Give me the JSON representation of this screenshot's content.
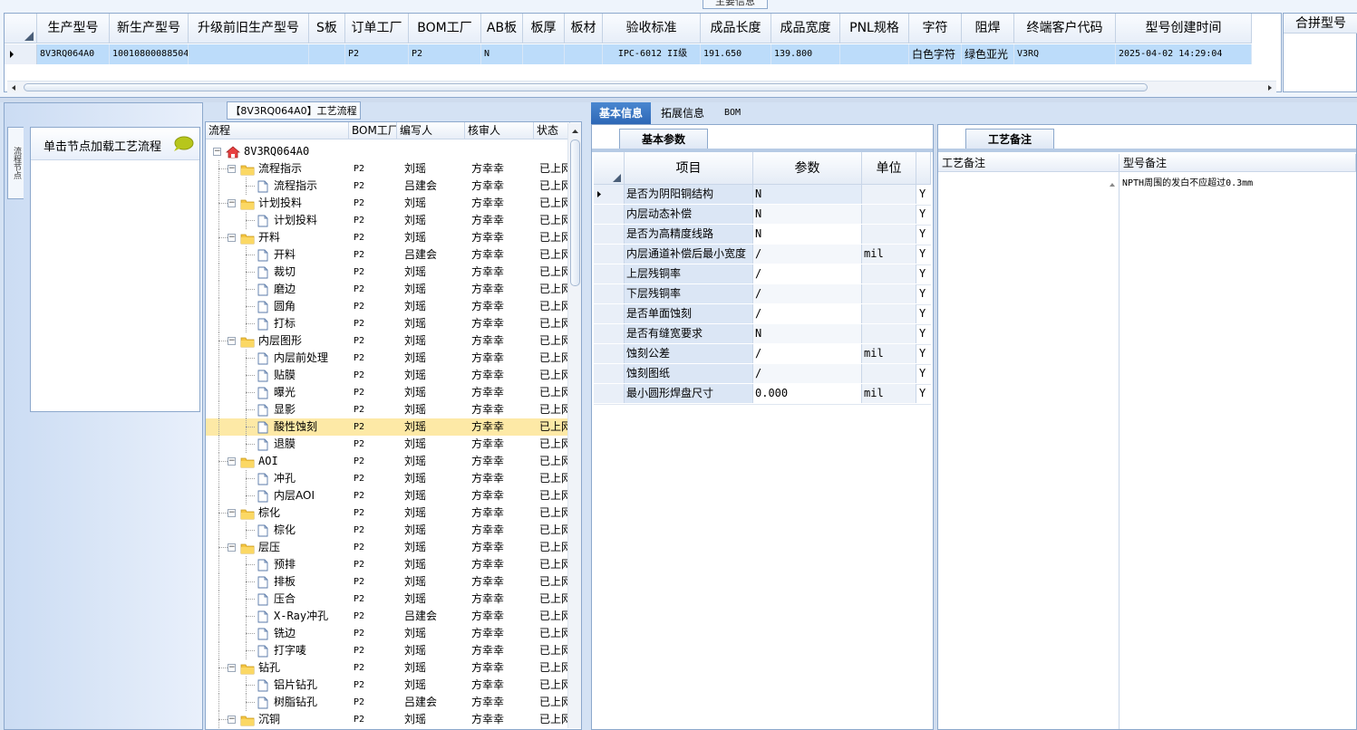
{
  "top": {
    "section_title": "主要信息",
    "columns": [
      "生产型号",
      "新生产型号",
      "升级前旧生产型号",
      "S板",
      "订单工厂",
      "BOM工厂",
      "AB板",
      "板厚",
      "板材",
      "验收标准",
      "成品长度",
      "成品宽度",
      "PNL规格",
      "字符",
      "阻焊",
      "终端客户代码",
      "型号创建时间"
    ],
    "row": [
      "8V3RQ064A0",
      "10010800088504",
      "",
      "",
      "P2",
      "P2",
      "N",
      "",
      "",
      "IPC-6012 II级",
      "191.650",
      "139.800",
      "",
      "白色字符",
      "绿色亚光",
      "V3RQ",
      "2025-04-02 14:29:04"
    ],
    "right_column": "合拼型号"
  },
  "left": {
    "vertical_tab": "流程节点",
    "node_hint": "单击节点加载工艺流程",
    "icons": {
      "chat": "speech-bubble-icon"
    }
  },
  "tree": {
    "title": "【8V3RQ064A0】工艺流程",
    "columns": [
      "流程",
      "BOM工厂",
      "编写人",
      "核审人",
      "状态"
    ],
    "root": "8V3RQ064A0",
    "rows": [
      {
        "name": "流程指示",
        "level": 1,
        "type": "folder",
        "factory": "P2",
        "writer": "刘瑶",
        "reviewer": "方幸幸",
        "status": "已上网"
      },
      {
        "name": "流程指示",
        "level": 2,
        "type": "file",
        "factory": "P2",
        "writer": "吕建会",
        "reviewer": "方幸幸",
        "status": "已上网"
      },
      {
        "name": "计划投料",
        "level": 1,
        "type": "folder",
        "factory": "P2",
        "writer": "刘瑶",
        "reviewer": "方幸幸",
        "status": "已上网"
      },
      {
        "name": "计划投料",
        "level": 2,
        "type": "file",
        "factory": "P2",
        "writer": "刘瑶",
        "reviewer": "方幸幸",
        "status": "已上网"
      },
      {
        "name": "开料",
        "level": 1,
        "type": "folder",
        "factory": "P2",
        "writer": "刘瑶",
        "reviewer": "方幸幸",
        "status": "已上网"
      },
      {
        "name": "开料",
        "level": 2,
        "type": "file",
        "factory": "P2",
        "writer": "吕建会",
        "reviewer": "方幸幸",
        "status": "已上网"
      },
      {
        "name": "裁切",
        "level": 2,
        "type": "file",
        "factory": "P2",
        "writer": "刘瑶",
        "reviewer": "方幸幸",
        "status": "已上网"
      },
      {
        "name": "磨边",
        "level": 2,
        "type": "file",
        "factory": "P2",
        "writer": "刘瑶",
        "reviewer": "方幸幸",
        "status": "已上网"
      },
      {
        "name": "圆角",
        "level": 2,
        "type": "file",
        "factory": "P2",
        "writer": "刘瑶",
        "reviewer": "方幸幸",
        "status": "已上网"
      },
      {
        "name": "打标",
        "level": 2,
        "type": "file",
        "factory": "P2",
        "writer": "刘瑶",
        "reviewer": "方幸幸",
        "status": "已上网"
      },
      {
        "name": "内层图形",
        "level": 1,
        "type": "folder",
        "factory": "P2",
        "writer": "刘瑶",
        "reviewer": "方幸幸",
        "status": "已上网"
      },
      {
        "name": "内层前处理",
        "level": 2,
        "type": "file",
        "factory": "P2",
        "writer": "刘瑶",
        "reviewer": "方幸幸",
        "status": "已上网"
      },
      {
        "name": "贴膜",
        "level": 2,
        "type": "file",
        "factory": "P2",
        "writer": "刘瑶",
        "reviewer": "方幸幸",
        "status": "已上网"
      },
      {
        "name": "曝光",
        "level": 2,
        "type": "file",
        "factory": "P2",
        "writer": "刘瑶",
        "reviewer": "方幸幸",
        "status": "已上网"
      },
      {
        "name": "显影",
        "level": 2,
        "type": "file",
        "factory": "P2",
        "writer": "刘瑶",
        "reviewer": "方幸幸",
        "status": "已上网"
      },
      {
        "name": "酸性蚀刻",
        "level": 2,
        "type": "file",
        "factory": "P2",
        "writer": "刘瑶",
        "reviewer": "方幸幸",
        "status": "已上网",
        "selected": true
      },
      {
        "name": "退膜",
        "level": 2,
        "type": "file",
        "factory": "P2",
        "writer": "刘瑶",
        "reviewer": "方幸幸",
        "status": "已上网"
      },
      {
        "name": "AOI",
        "level": 1,
        "type": "folder",
        "factory": "P2",
        "writer": "刘瑶",
        "reviewer": "方幸幸",
        "status": "已上网"
      },
      {
        "name": "冲孔",
        "level": 2,
        "type": "file",
        "factory": "P2",
        "writer": "刘瑶",
        "reviewer": "方幸幸",
        "status": "已上网"
      },
      {
        "name": "内层AOI",
        "level": 2,
        "type": "file",
        "factory": "P2",
        "writer": "刘瑶",
        "reviewer": "方幸幸",
        "status": "已上网"
      },
      {
        "name": "棕化",
        "level": 1,
        "type": "folder",
        "factory": "P2",
        "writer": "刘瑶",
        "reviewer": "方幸幸",
        "status": "已上网"
      },
      {
        "name": "棕化",
        "level": 2,
        "type": "file",
        "factory": "P2",
        "writer": "刘瑶",
        "reviewer": "方幸幸",
        "status": "已上网"
      },
      {
        "name": "层压",
        "level": 1,
        "type": "folder",
        "factory": "P2",
        "writer": "刘瑶",
        "reviewer": "方幸幸",
        "status": "已上网"
      },
      {
        "name": "预排",
        "level": 2,
        "type": "file",
        "factory": "P2",
        "writer": "刘瑶",
        "reviewer": "方幸幸",
        "status": "已上网"
      },
      {
        "name": "排板",
        "level": 2,
        "type": "file",
        "factory": "P2",
        "writer": "刘瑶",
        "reviewer": "方幸幸",
        "status": "已上网"
      },
      {
        "name": "压合",
        "level": 2,
        "type": "file",
        "factory": "P2",
        "writer": "刘瑶",
        "reviewer": "方幸幸",
        "status": "已上网"
      },
      {
        "name": "X-Ray冲孔",
        "level": 2,
        "type": "file",
        "factory": "P2",
        "writer": "吕建会",
        "reviewer": "方幸幸",
        "status": "已上网"
      },
      {
        "name": "铣边",
        "level": 2,
        "type": "file",
        "factory": "P2",
        "writer": "刘瑶",
        "reviewer": "方幸幸",
        "status": "已上网"
      },
      {
        "name": "打字唛",
        "level": 2,
        "type": "file",
        "factory": "P2",
        "writer": "刘瑶",
        "reviewer": "方幸幸",
        "status": "已上网"
      },
      {
        "name": "钻孔",
        "level": 1,
        "type": "folder",
        "factory": "P2",
        "writer": "刘瑶",
        "reviewer": "方幸幸",
        "status": "已上网"
      },
      {
        "name": "铝片钻孔",
        "level": 2,
        "type": "file",
        "factory": "P2",
        "writer": "刘瑶",
        "reviewer": "方幸幸",
        "status": "已上网"
      },
      {
        "name": "树脂钻孔",
        "level": 2,
        "type": "file",
        "factory": "P2",
        "writer": "吕建会",
        "reviewer": "方幸幸",
        "status": "已上网"
      },
      {
        "name": "沉铜",
        "level": 1,
        "type": "folder",
        "factory": "P2",
        "writer": "刘瑶",
        "reviewer": "方幸幸",
        "status": "已上网"
      }
    ]
  },
  "tabs": [
    "基本信息",
    "拓展信息",
    "BOM"
  ],
  "basic": {
    "title": "基本参数",
    "columns": [
      "项目",
      "参数",
      "单位"
    ],
    "rows": [
      {
        "item": "是否为阴阳铜结构",
        "param": "N",
        "unit": "",
        "flag": "Y"
      },
      {
        "item": "内层动态补偿",
        "param": "N",
        "unit": "",
        "flag": "Y"
      },
      {
        "item": "是否为高精度线路",
        "param": "N",
        "unit": "",
        "flag": "Y"
      },
      {
        "item": "内层通道补偿后最小宽度",
        "param": "/",
        "unit": "mil",
        "flag": "Y"
      },
      {
        "item": "上层残铜率",
        "param": "/",
        "unit": "",
        "flag": "Y"
      },
      {
        "item": "下层残铜率",
        "param": "/",
        "unit": "",
        "flag": "Y"
      },
      {
        "item": "是否单面蚀刻",
        "param": "/",
        "unit": "",
        "flag": "Y"
      },
      {
        "item": "是否有缝宽要求",
        "param": "N",
        "unit": "",
        "flag": "Y"
      },
      {
        "item": "蚀刻公差",
        "param": "/",
        "unit": "mil",
        "flag": "Y"
      },
      {
        "item": "蚀刻图纸",
        "param": "/",
        "unit": "",
        "flag": "Y"
      },
      {
        "item": "最小圆形焊盘尺寸",
        "param": "0.000",
        "unit": "mil",
        "flag": "Y"
      }
    ]
  },
  "notes": {
    "title": "工艺备注",
    "columns": [
      "工艺备注",
      "型号备注"
    ],
    "model_note": "NPTH周围的发白不应超过0.3mm"
  },
  "colors": {
    "selected_row": "#bcdcfa",
    "tree_selected": "#fde9a6",
    "active_tab": "#2d67b6"
  }
}
